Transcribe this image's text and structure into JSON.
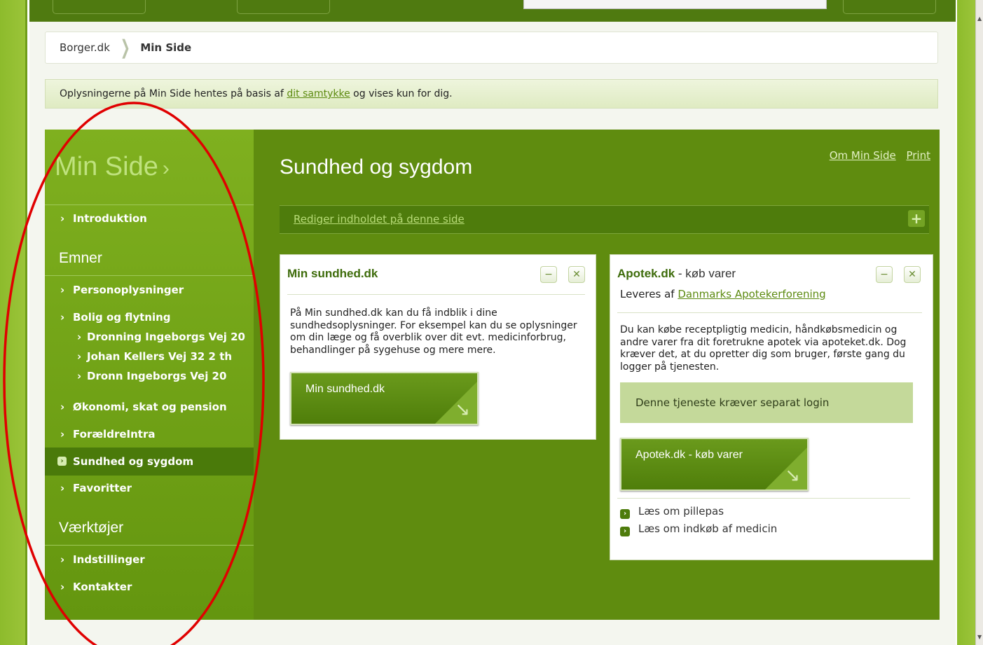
{
  "breadcrumb": {
    "home": "Borger.dk",
    "current": "Min Side"
  },
  "consent": {
    "before": "Oplysningerne på Min Side hentes på basis af ",
    "link": "dit samtykke",
    "after": " og vises kun for dig."
  },
  "nav": {
    "title": "Min Side",
    "title_chevron": "›",
    "intro": "Introduktion",
    "emner_heading": "Emner",
    "items": [
      {
        "label": "Personoplysninger"
      },
      {
        "label": "Bolig og flytning"
      }
    ],
    "addresses": [
      "Dronning Ingeborgs Vej 20",
      "Johan Kellers Vej 32 2 th",
      "Dronn Ingeborgs Vej 20"
    ],
    "more_items": [
      {
        "label": "Økonomi, skat og pension"
      },
      {
        "label": "ForældreIntra"
      }
    ],
    "active": "Sundhed og sygdom",
    "favorites": "Favoritter",
    "tools_heading": "Værktøjer",
    "tools": [
      {
        "label": "Indstillinger"
      },
      {
        "label": "Kontakter"
      }
    ],
    "bullet": "›"
  },
  "content": {
    "title": "Sundhed og sygdom",
    "links": {
      "about": "Om Min Side",
      "print": "Print"
    },
    "edit_link": "Rediger indholdet på denne side",
    "plus": "+"
  },
  "widget1": {
    "title": "Min sundhed.dk",
    "body": "På Min sundhed.dk kan du få indblik i dine sundhedsoplysninger. For eksempel kan du se oplysninger om din læge og få overblik over dit evt. medicinforbrug, behandlinger på sygehuse og mere mere.",
    "cta": "Min sundhed.dk",
    "minimize": "−",
    "close": "✕"
  },
  "widget2": {
    "title": "Apotek.dk",
    "title_suffix": " - køb varer",
    "provider_prefix": "Leveres af ",
    "provider": "Danmarks Apotekerforening",
    "body": "Du kan købe receptpligtig medicin, håndkøbsmedicin og andre varer fra dit foretrukne apotek via apoteket.dk. Dog kræver det, at du opretter dig som bruger, første gang du logger på tjenesten.",
    "login_note": "Denne tjeneste kræver separat login",
    "cta": "Apotek.dk - køb varer",
    "links": [
      "Læs om pillepas",
      "Læs om indkøb af medicin"
    ],
    "minimize": "−",
    "close": "✕"
  },
  "colors": {
    "brand_green": "#5f8c0f",
    "nav_green": "#7fb01f",
    "annotation": "#e00000"
  }
}
